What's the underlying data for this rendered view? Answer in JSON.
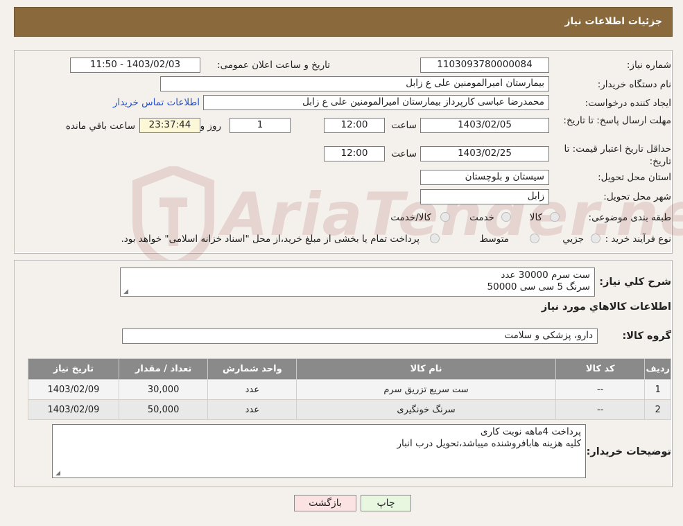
{
  "header": {
    "title": "جزئیات اطلاعات نیاز"
  },
  "form": {
    "need_number_label": "شماره نیاز:",
    "need_number": "1103093780000084",
    "announce_label": "تاریخ و ساعت اعلان عمومی:",
    "announce_value": "1403/02/03 - 11:50",
    "buyer_org_label": "نام دستگاه خریدار:",
    "buyer_org": "بیمارستان امیرالمومنین علی  ع  زابل",
    "creator_label": "ایجاد کننده درخواست:",
    "creator": "محمدرضا عباسی کارپرداز بیمارستان امیرالمومنین علی  ع  زابل",
    "contact_link": "اطلاعات تماس خریدار",
    "deadline_label": "مهلت ارسال پاسخ: تا تاریخ:",
    "deadline_date": "1403/02/05",
    "time_label": "ساعت",
    "deadline_time": "12:00",
    "days_value": "1",
    "days_label": "روز و",
    "remaining_time": "23:37:44",
    "remaining_label": "ساعت باقي مانده",
    "price_validity_label": "حداقل تاریخ اعتبار قیمت: تا تاریخ:",
    "price_validity_date": "1403/02/25",
    "price_validity_time": "12:00",
    "province_label": "استان محل تحویل:",
    "province": "سیستان و بلوچستان",
    "city_label": "شهر محل تحویل:",
    "city": "زابل",
    "category_label": "طبقه بندی موضوعی:",
    "category_options": [
      "کالا",
      "خدمت",
      "کالا/خدمت"
    ],
    "process_label": "نوع فرآیند خرید :",
    "process_options": [
      "جزیي",
      "متوسط"
    ],
    "process_note": "پرداخت تمام یا بخشی از مبلغ خرید،از محل \"اسناد خزانه اسلامی\" خواهد بود."
  },
  "details": {
    "summary_label": "شرح کلي نياز:",
    "summary_line1": "ست سرم 30000 عدد",
    "summary_line2": "سرنگ 5 سی سی 50000",
    "goods_info_title": "اطلاعات کالاهاي مورد نياز",
    "goods_group_label": "گروه کالا:",
    "goods_group": "دارو، پزشکی و سلامت"
  },
  "table": {
    "headers": [
      "رديف",
      "کد کالا",
      "نام کالا",
      "واحد شمارش",
      "تعداد / مقدار",
      "تاریخ نیاز"
    ],
    "rows": [
      [
        "1",
        "--",
        "ست سریع تزریق سرم",
        "عدد",
        "30,000",
        "1403/02/09"
      ],
      [
        "2",
        "--",
        "سرنگ خونگیری",
        "عدد",
        "50,000",
        "1403/02/09"
      ]
    ]
  },
  "buyer_notes": {
    "label": "توضیحات خریدار:",
    "line1": "پرداخت 4ماهه نوبت کاری",
    "line2": "کلیه هزینه هابافروشنده میباشد،تحویل درب انبار"
  },
  "buttons": {
    "print": "چاپ",
    "back": "بازگشت"
  },
  "colors": {
    "header_bg": "#8a6a3c",
    "table_header_bg": "#8a8a8a",
    "print_bg": "#e8f8e0",
    "back_bg": "#fbe3e3"
  }
}
